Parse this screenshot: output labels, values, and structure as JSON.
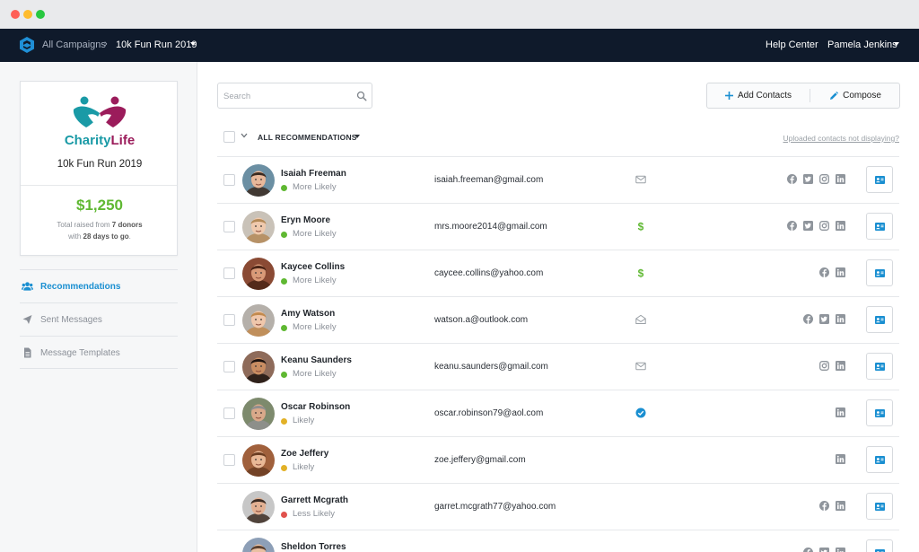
{
  "nav": {
    "breadcrumb_root": "All Campaigns",
    "breadcrumb_sep": "›",
    "breadcrumb_current": "10k Fun Run 2019",
    "help": "Help Center",
    "user": "Pamela Jenkins"
  },
  "campaign": {
    "org_part1": "Charity",
    "org_part2": "Life",
    "name": "10k Fun Run 2019",
    "raised": "$1,250",
    "note_prefix": "Total raised from ",
    "donors": "7 donors",
    "note_mid": "with ",
    "days": "28 days to go",
    "note_suffix": "."
  },
  "sidebar": {
    "items": [
      {
        "label": "Recommendations",
        "icon": "users-icon",
        "active": true
      },
      {
        "label": "Sent Messages",
        "icon": "paper-plane-icon",
        "active": false
      },
      {
        "label": "Message Templates",
        "icon": "document-icon",
        "active": false
      }
    ]
  },
  "toolbar": {
    "search_placeholder": "Search",
    "add_label": "Add Contacts",
    "compose_label": "Compose"
  },
  "list": {
    "filter_label": "ALL RECOMMENDATIONS",
    "uploaded_link": "Uploaded contacts not displaying?"
  },
  "colors": {
    "more_likely": "#5fb832",
    "likely": "#e2b127",
    "less_likely": "#e0524d",
    "accent": "#1a8fd1"
  },
  "contacts": [
    {
      "name": "Isaiah Freeman",
      "likelihood": "More Likely",
      "level": "more",
      "email": "isaiah.freeman@gmail.com",
      "status": "envelope-icon",
      "socials": [
        "facebook",
        "twitter",
        "instagram",
        "linkedin"
      ],
      "checkbox": true
    },
    {
      "name": "Eryn Moore",
      "likelihood": "More Likely",
      "level": "more",
      "email": "mrs.moore2014@gmail.com",
      "status": "dollar-icon",
      "socials": [
        "facebook",
        "twitter",
        "instagram",
        "linkedin"
      ],
      "checkbox": true
    },
    {
      "name": "Kaycee Collins",
      "likelihood": "More Likely",
      "level": "more",
      "email": "caycee.collins@yahoo.com",
      "status": "dollar-icon",
      "socials": [
        "facebook",
        "linkedin"
      ],
      "checkbox": true
    },
    {
      "name": "Amy Watson",
      "likelihood": "More Likely",
      "level": "more",
      "email": "watson.a@outlook.com",
      "status": "envelope-open-icon",
      "socials": [
        "facebook",
        "twitter",
        "linkedin"
      ],
      "checkbox": true
    },
    {
      "name": "Keanu Saunders",
      "likelihood": "More Likely",
      "level": "more",
      "email": "keanu.saunders@gmail.com",
      "status": "envelope-icon",
      "socials": [
        "instagram",
        "linkedin"
      ],
      "checkbox": true
    },
    {
      "name": "Oscar Robinson",
      "likelihood": "Likely",
      "level": "likely",
      "email": "oscar.robinson79@aol.com",
      "status": "check-circle-icon",
      "socials": [
        "linkedin"
      ],
      "checkbox": true
    },
    {
      "name": "Zoe Jeffery",
      "likelihood": "Likely",
      "level": "likely",
      "email": "zoe.jeffery@gmail.com",
      "status": "",
      "socials": [
        "linkedin"
      ],
      "checkbox": true
    },
    {
      "name": "Garrett Mcgrath",
      "likelihood": "Less Likely",
      "level": "less",
      "email": "garret.mcgrath77@yahoo.com",
      "status": "",
      "socials": [
        "facebook",
        "linkedin"
      ],
      "checkbox": false
    },
    {
      "name": "Sheldon Torres",
      "likelihood": "",
      "level": "less",
      "email": "",
      "status": "",
      "socials": [
        "facebook",
        "twitter",
        "linkedin"
      ],
      "checkbox": false
    }
  ]
}
